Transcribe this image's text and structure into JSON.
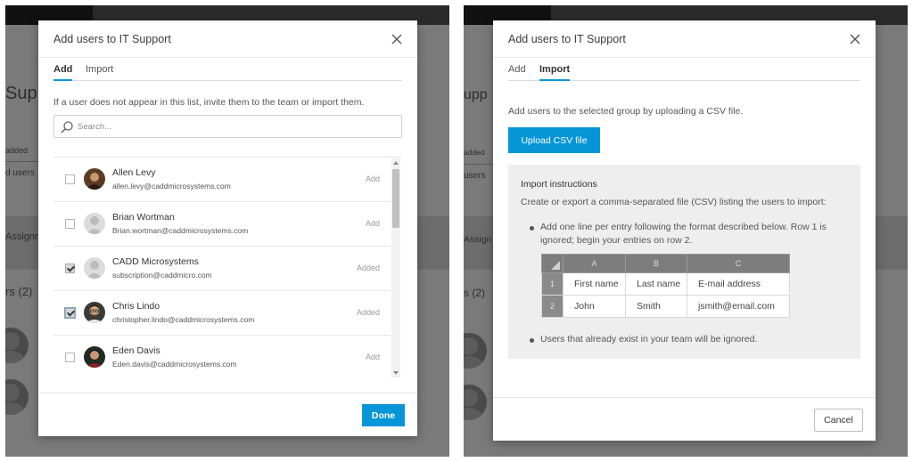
{
  "background": {
    "left": {
      "title_fragment": "Supp",
      "label_added": "added",
      "label_users": "d users",
      "label_assign": "Assignm",
      "members_count": "rs (2)"
    },
    "right": {
      "title_fragment": "upp",
      "label_added": "added",
      "label_users": "users",
      "label_assign": "Assign",
      "members_count": "s (2)"
    }
  },
  "add_dialog": {
    "title": "Add users to IT Support",
    "tabs": [
      {
        "label": "Add",
        "active": true
      },
      {
        "label": "Import",
        "active": false
      }
    ],
    "hint": "If a user does not appear in this list, invite them to the team or import them.",
    "search_placeholder": "Search...",
    "users": [
      {
        "name": "Allen Levy",
        "email": "allen.levy@caddmicrosystems.com",
        "action": "Add",
        "checked": false
      },
      {
        "name": "Brian Wortman",
        "email": "Brian.wortman@caddmicrosystems.com",
        "action": "Add",
        "checked": false
      },
      {
        "name": "CADD Microsystems",
        "email": "subscription@caddmicro.com",
        "action": "Added",
        "checked": true
      },
      {
        "name": "Chris Lindo",
        "email": "christopher.lindo@caddmicrosystems.com",
        "action": "Added",
        "checked": true
      },
      {
        "name": "Eden Davis",
        "email": "Eden.davis@caddmicrosystems.com",
        "action": "Add",
        "checked": false
      }
    ],
    "done_label": "Done"
  },
  "import_dialog": {
    "title": "Add users to IT Support",
    "tabs": [
      {
        "label": "Add",
        "active": false
      },
      {
        "label": "Import",
        "active": true
      }
    ],
    "description": "Add users to the selected group by uploading a CSV file.",
    "upload_label": "Upload CSV file",
    "instructions": {
      "title": "Import instructions",
      "subtitle": "Create or export a comma-separated file (CSV) listing the users to import:",
      "bullet1_line1": "Add one line per entry following the format described below. Row 1 is",
      "bullet1_line2": "ignored; begin your entries on row 2.",
      "table": {
        "columns": [
          "A",
          "B",
          "C"
        ],
        "rows": [
          {
            "num": "1",
            "cells": [
              "First name",
              "Last name",
              "E-mail address"
            ]
          },
          {
            "num": "2",
            "cells": [
              "John",
              "Smith",
              "jsmith@email.com"
            ]
          }
        ]
      },
      "bullet2": "Users that already exist in your team will be ignored."
    },
    "cancel_label": "Cancel"
  },
  "colors": {
    "accent": "#0696d7",
    "overlay": "#7a7a7a",
    "instructions_bg": "#eeeeee"
  }
}
